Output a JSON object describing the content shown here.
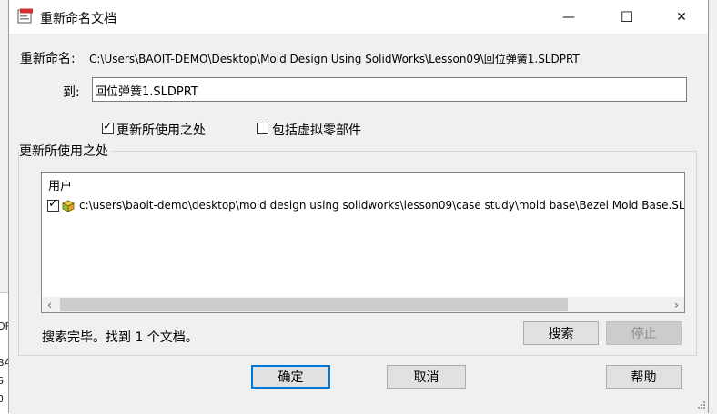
{
  "window": {
    "title": "重新命名文档",
    "minimize_glyph": "—",
    "maximize_glyph": "☐",
    "close_glyph": "✕"
  },
  "rename": {
    "label": "重新命名:",
    "source_path": "C:\\Users\\BAOIT-DEMO\\Desktop\\Mold Design Using SolidWorks\\Lesson09\\回位弹簧1.SLDPRT",
    "to_label": "到:",
    "to_value": "回位弹簧1.SLDPRT"
  },
  "options": {
    "update_where_used": {
      "label": "更新所使用之处",
      "checked": true
    },
    "include_virtual": {
      "label": "包括虚拟零部件",
      "checked": false
    }
  },
  "where_used": {
    "group_title": "更新所使用之处",
    "column_header": "用户",
    "rows": [
      {
        "checked": true,
        "icon": "assembly-icon",
        "path": "c:\\users\\baoit-demo\\desktop\\mold design using solidworks\\lesson09\\case study\\mold base\\Bezel Mold Base.SLDASM"
      }
    ],
    "scroll_left": "‹",
    "scroll_right": "›"
  },
  "status": {
    "text": "搜索完毕。找到 1 个文档。",
    "search_label": "搜索",
    "stop_label": "停止"
  },
  "footer": {
    "ok_label": "确定",
    "cancel_label": "取消",
    "help_label": "帮助"
  },
  "background_fragments": [
    "OF",
    "BA",
    "S",
    "0"
  ],
  "colors": {
    "focus_border": "#0078d7",
    "disabled_text": "#8a8a8a"
  }
}
